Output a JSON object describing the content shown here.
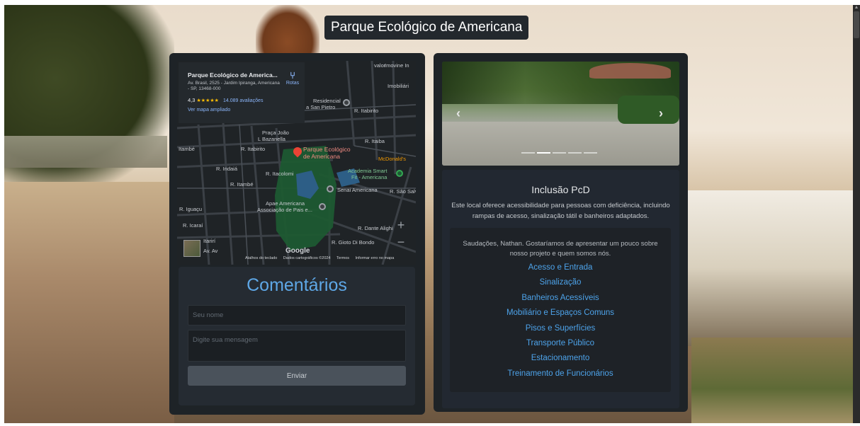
{
  "page": {
    "title": "Parque Ecológico de Americana"
  },
  "map": {
    "place_name": "Parque Ecológico de America...",
    "address": "Av. Brasil, 2525 - Jardim Ipiranga, Americana - SP, 13468-000",
    "rating": "4,3",
    "stars": "★★★★★",
    "reviews": "14.089 avaliações",
    "enlarge_link": "Ver mapa ampliado",
    "route_label": "Rotas",
    "labels": {
      "imovine": "Imovine In",
      "imobiliaria": "Imobiliári",
      "residencial": "Residencial",
      "sao_pietro": "a San Pietro",
      "itabirito_r": "R. Itabirito",
      "itaiba": "R. Itaiba",
      "praca_1": "Praça João",
      "praca_2": "L Bazanella",
      "poi_1": "Parque Ecológico",
      "poi_2": "de Americana",
      "mcdonalds": "McDonald's",
      "academia_1": "Academia Smart",
      "academia_2": "Fit - Americana",
      "senai": "Senai Americana",
      "apae_1": "Apae Americana",
      "apae_2": "Associação de Pais e...",
      "iguacu": "R. Iguaçu",
      "itambe": "Itambé",
      "itamb": "R. Itambé",
      "itabirito_v": "R. Itabirito",
      "indaia": "R. Indaiá",
      "itacolomi": "R. Itacolomi",
      "itararé": "Itarirí",
      "dante": "R. Dante Alighi",
      "gioto": "R. Gioto Di Bondo",
      "sao_salv": "R. São Salv",
      "icarai": "R. Icaraí",
      "av": "Av. Av",
      "vaior": "valor"
    },
    "zoom_in": "+",
    "zoom_out": "−",
    "google": "Google",
    "footer": {
      "shortcuts": "Atalhos do teclado",
      "map_data": "Dados cartográficos ©2024",
      "terms": "Termos",
      "report": "Informar erro no mapa"
    }
  },
  "comments": {
    "title": "Comentários",
    "name_placeholder": "Seu nome",
    "message_placeholder": "Digite sua mensagem",
    "send_label": "Enviar"
  },
  "carousel": {
    "prev": "‹",
    "next": "›",
    "indicator_count": 5,
    "active_index": 1
  },
  "pcd": {
    "title": "Inclusão PcD",
    "description": "Este local oferece acessibilidade para pessoas com deficiência, incluindo rampas de acesso, sinalização tátil e banheiros adaptados.",
    "intro": "Saudações, Nathan. Gostaríamos de apresentar um pouco sobre nosso projeto e quem somos nós.",
    "links": [
      "Acesso e Entrada",
      "Sinalização",
      "Banheiros Acessíveis",
      "Mobiliário e Espaços Comuns",
      "Pisos e Superfícies",
      "Transporte Público",
      "Estacionamento",
      "Treinamento de Funcionários"
    ]
  },
  "colors": {
    "accent": "#5ea7e6",
    "link": "#4da3ea",
    "panel": "#1e2327"
  }
}
